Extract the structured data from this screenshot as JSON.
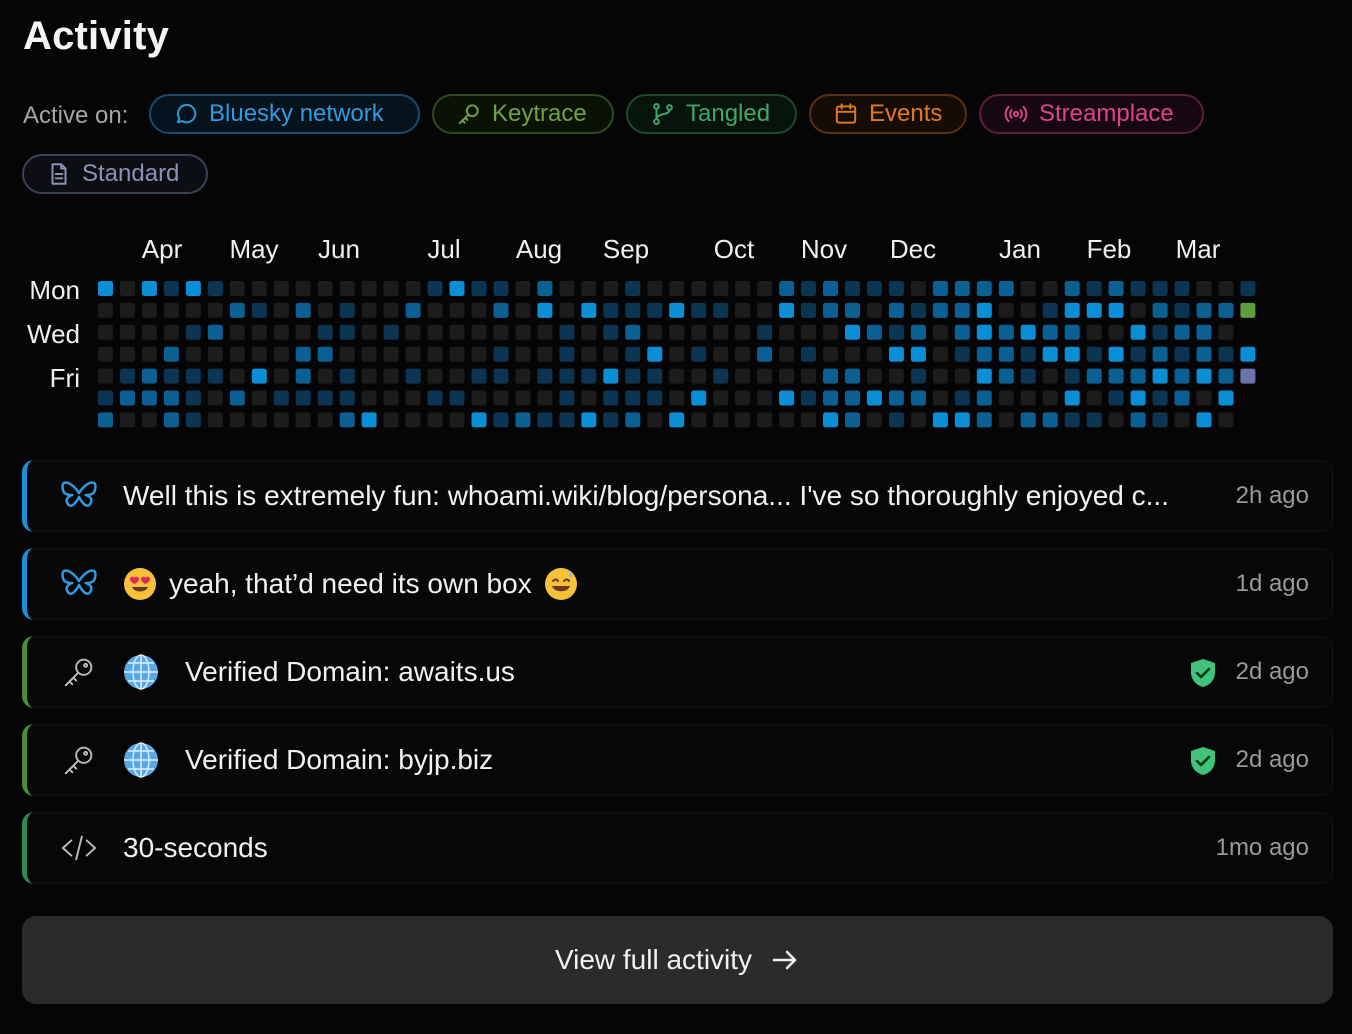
{
  "title": "Activity",
  "active_on": {
    "label": "Active on:",
    "chips": [
      {
        "label": "Bluesky network",
        "icon": "chat-bubble-icon",
        "color": "#2f9be0"
      },
      {
        "label": "Keytrace",
        "icon": "key-icon",
        "color": "#6ea345"
      },
      {
        "label": "Tangled",
        "icon": "git-branch-icon",
        "color": "#3fa768"
      },
      {
        "label": "Events",
        "icon": "calendar-icon",
        "color": "#e07a22"
      },
      {
        "label": "Streamplace",
        "icon": "broadcast-icon",
        "color": "#d9468a"
      },
      {
        "label": "Standard",
        "icon": "document-icon",
        "color": "#8a93b5"
      }
    ]
  },
  "heatmap": {
    "months": [
      "Apr",
      "May",
      "Jun",
      "Jul",
      "Aug",
      "Sep",
      "Oct",
      "Nov",
      "Dec",
      "Jan",
      "Feb",
      "Mar"
    ],
    "day_labels": [
      "Mon",
      "Wed",
      "Fri"
    ],
    "colors": {
      "empty": "#1c1c1c",
      "low": "#0c3553",
      "mid": "#0a5f93",
      "high": "#0a8fd6",
      "keytrace": "#5f9e3f",
      "standard": "#6b73a8"
    }
  },
  "activity": [
    {
      "source": "bluesky",
      "icon": "butterfly-icon",
      "text": "Well this is extremely fun: whoami.wiki/blog/persona... I've so thoroughly enjoyed c...",
      "time": "2h ago",
      "accent": "#1d8fd8"
    },
    {
      "source": "bluesky",
      "icon": "butterfly-icon",
      "text": "yeah, that’d need its own box",
      "time": "1d ago",
      "accent": "#1d8fd8"
    },
    {
      "source": "keytrace",
      "icon": "key-icon",
      "text": "Verified Domain: awaits.us",
      "time": "2d ago",
      "accent": "#4f8a34",
      "verified": true
    },
    {
      "source": "keytrace",
      "icon": "key-icon",
      "text": "Verified Domain: byjp.biz",
      "time": "2d ago",
      "accent": "#4f8a34",
      "verified": true
    },
    {
      "source": "tangled",
      "icon": "code-icon",
      "text": "30-seconds",
      "time": "1mo ago",
      "accent": "#2f8a52"
    }
  ],
  "footer": {
    "button_label": "View full activity"
  }
}
